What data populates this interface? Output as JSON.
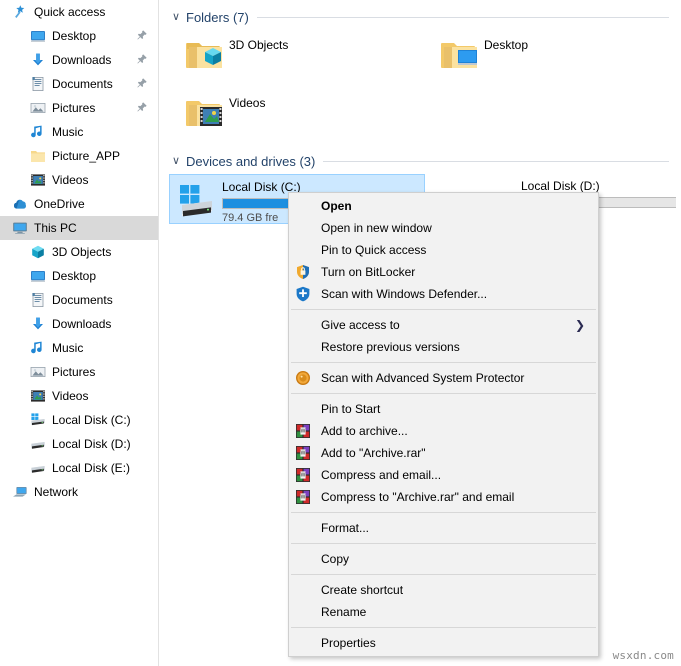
{
  "sidebar": {
    "items": [
      {
        "label": "Quick access",
        "icon": "star-pin-icon",
        "level": 0,
        "pinned": false,
        "selected": false
      },
      {
        "label": "Desktop",
        "icon": "desktop-icon",
        "level": 1,
        "pinned": true,
        "selected": false
      },
      {
        "label": "Downloads",
        "icon": "downloads-icon",
        "level": 1,
        "pinned": true,
        "selected": false
      },
      {
        "label": "Documents",
        "icon": "documents-icon",
        "level": 1,
        "pinned": true,
        "selected": false
      },
      {
        "label": "Pictures",
        "icon": "pictures-icon",
        "level": 1,
        "pinned": true,
        "selected": false
      },
      {
        "label": "Music",
        "icon": "music-icon",
        "level": 1,
        "pinned": false,
        "selected": false
      },
      {
        "label": "Picture_APP",
        "icon": "folder-icon",
        "level": 1,
        "pinned": false,
        "selected": false
      },
      {
        "label": "Videos",
        "icon": "videos-icon",
        "level": 1,
        "pinned": false,
        "selected": false
      },
      {
        "label": "OneDrive",
        "icon": "onedrive-cloud-icon",
        "level": 0,
        "pinned": false,
        "selected": false
      },
      {
        "label": "This PC",
        "icon": "this-pc-icon",
        "level": 0,
        "pinned": false,
        "selected": true
      },
      {
        "label": "3D Objects",
        "icon": "3d-objects-icon",
        "level": 1,
        "pinned": false,
        "selected": false
      },
      {
        "label": "Desktop",
        "icon": "desktop-icon",
        "level": 1,
        "pinned": false,
        "selected": false
      },
      {
        "label": "Documents",
        "icon": "documents-icon",
        "level": 1,
        "pinned": false,
        "selected": false
      },
      {
        "label": "Downloads",
        "icon": "downloads-icon",
        "level": 1,
        "pinned": false,
        "selected": false
      },
      {
        "label": "Music",
        "icon": "music-icon",
        "level": 1,
        "pinned": false,
        "selected": false
      },
      {
        "label": "Pictures",
        "icon": "pictures-icon",
        "level": 1,
        "pinned": false,
        "selected": false
      },
      {
        "label": "Videos",
        "icon": "videos-icon",
        "level": 1,
        "pinned": false,
        "selected": false
      },
      {
        "label": "Local Disk (C:)",
        "icon": "drive-windows-icon",
        "level": 1,
        "pinned": false,
        "selected": false
      },
      {
        "label": "Local Disk (D:)",
        "icon": "drive-icon",
        "level": 1,
        "pinned": false,
        "selected": false
      },
      {
        "label": "Local Disk (E:)",
        "icon": "drive-icon",
        "level": 1,
        "pinned": false,
        "selected": false
      },
      {
        "label": "Network",
        "icon": "network-icon",
        "level": 0,
        "pinned": false,
        "selected": false
      }
    ]
  },
  "content": {
    "folders_group": {
      "title": "Folders (7)",
      "chevron": "∨",
      "items": [
        {
          "name": "3D Objects",
          "icon": "folder-3d-objects-icon"
        },
        {
          "name": "Desktop",
          "icon": "folder-desktop-icon"
        },
        {
          "name": "Videos",
          "icon": "folder-videos-icon"
        }
      ]
    },
    "drives_group": {
      "title": "Devices and drives (3)",
      "chevron": "∨",
      "items": [
        {
          "name": "Local Disk (C:)",
          "free": "79.4 GB fre",
          "used_percent": 58,
          "selected": true,
          "icon": "drive-windows-icon"
        },
        {
          "name": "Local Disk (D:)",
          "free": "",
          "used_percent": 2,
          "selected": false,
          "icon": "drive-icon"
        }
      ]
    }
  },
  "context_menu": {
    "items": [
      {
        "label": "Open",
        "icon": "",
        "bold": true,
        "sep_after": false,
        "arrow": false
      },
      {
        "label": "Open in new window",
        "icon": "",
        "bold": false,
        "sep_after": false,
        "arrow": false
      },
      {
        "label": "Pin to Quick access",
        "icon": "",
        "bold": false,
        "sep_after": false,
        "arrow": false
      },
      {
        "label": "Turn on BitLocker",
        "icon": "bitlocker-shield-icon",
        "bold": false,
        "sep_after": false,
        "arrow": false
      },
      {
        "label": "Scan with Windows Defender...",
        "icon": "windows-defender-icon",
        "bold": false,
        "sep_after": true,
        "arrow": false
      },
      {
        "label": "Give access to",
        "icon": "",
        "bold": false,
        "sep_after": false,
        "arrow": true
      },
      {
        "label": "Restore previous versions",
        "icon": "",
        "bold": false,
        "sep_after": true,
        "arrow": false
      },
      {
        "label": "Scan with Advanced System Protector",
        "icon": "advanced-system-protector-icon",
        "bold": false,
        "sep_after": true,
        "arrow": false
      },
      {
        "label": "Pin to Start",
        "icon": "",
        "bold": false,
        "sep_after": false,
        "arrow": false
      },
      {
        "label": "Add to archive...",
        "icon": "winrar-icon",
        "bold": false,
        "sep_after": false,
        "arrow": false
      },
      {
        "label": "Add to \"Archive.rar\"",
        "icon": "winrar-icon",
        "bold": false,
        "sep_after": false,
        "arrow": false
      },
      {
        "label": "Compress and email...",
        "icon": "winrar-icon",
        "bold": false,
        "sep_after": false,
        "arrow": false
      },
      {
        "label": "Compress to \"Archive.rar\" and email",
        "icon": "winrar-icon",
        "bold": false,
        "sep_after": true,
        "arrow": false
      },
      {
        "label": "Format...",
        "icon": "",
        "bold": false,
        "sep_after": true,
        "arrow": false
      },
      {
        "label": "Copy",
        "icon": "",
        "bold": false,
        "sep_after": true,
        "arrow": false
      },
      {
        "label": "Create shortcut",
        "icon": "",
        "bold": false,
        "sep_after": false,
        "arrow": false
      },
      {
        "label": "Rename",
        "icon": "",
        "bold": false,
        "sep_after": true,
        "arrow": false
      },
      {
        "label": "Properties",
        "icon": "",
        "bold": false,
        "sep_after": false,
        "arrow": false
      }
    ],
    "submenu_arrow": "❯"
  },
  "watermark": "wsxdn.com",
  "colors": {
    "selection_blue": "#cce8ff",
    "sidebar_selection": "#d9d9d9",
    "group_header_text": "#23436a",
    "bar_blue": "#1d8fe0",
    "menu_bg": "#f2f2f2"
  }
}
